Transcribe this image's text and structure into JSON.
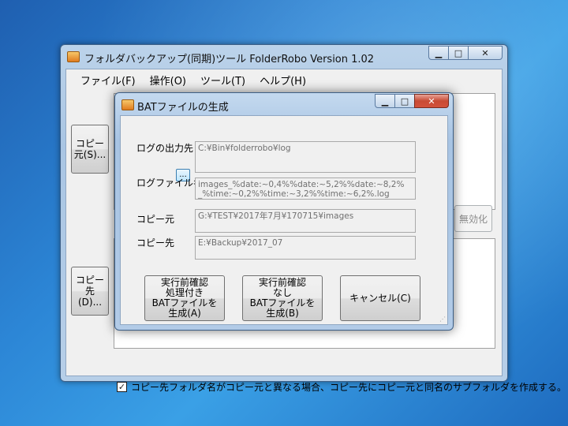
{
  "main_window": {
    "title": "フォルダバックアップ(同期)ツール FolderRobo Version 1.02",
    "caption": {
      "minimize": "▁",
      "maximize": "□",
      "close": "✕"
    },
    "menu": [
      "ファイル(F)",
      "操作(O)",
      "ツール(T)",
      "ヘルプ(H)"
    ],
    "copy_src_button": "コピー元(S)...",
    "copy_dst_button": "コピー先(D)...",
    "disable_button": "無効化",
    "subfolder_checkbox": {
      "checked": true,
      "label": "コピー先フォルダ名がコピー元と異なる場合、コピー先にコピー元と同名のサブフォルダを作成する。"
    }
  },
  "dialog": {
    "title": "BATファイルの生成",
    "caption": {
      "minimize": "▁",
      "maximize": "□",
      "close": "✕"
    },
    "log_output_label": "ログの出力先",
    "log_output_value": "C:¥Bin¥folderrobo¥log",
    "browse_label": "...",
    "log_file_label": "ログファイル名",
    "log_file_value": "images_%date:~0,4%%date:~5,2%%date:~8,2%_%time:~0,2%%time:~3,2%%time:~6,2%.log",
    "copy_src_label": "コピー元",
    "copy_src_value": "G:¥TEST¥2017年7月¥170715¥images",
    "copy_dst_label": "コピー先",
    "copy_dst_value": "E:¥Backup¥2017_07",
    "btn_with_confirm": [
      "実行前確認",
      "処理付き",
      "BATファイルを",
      "生成(A)"
    ],
    "btn_without_confirm": [
      "実行前確認",
      "なし",
      "BATファイルを",
      "生成(B)"
    ],
    "btn_cancel": "キャンセル(C)"
  }
}
